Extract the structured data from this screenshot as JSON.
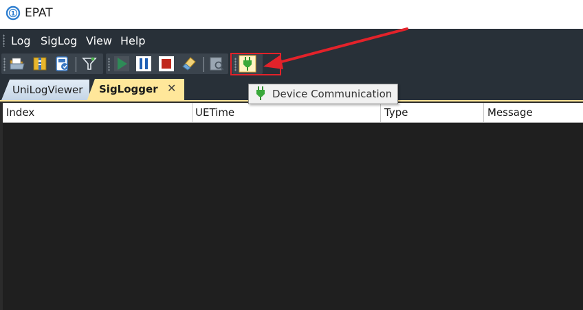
{
  "app": {
    "title": "EPAT"
  },
  "menu": {
    "items": [
      "Log",
      "SigLog",
      "View",
      "Help"
    ]
  },
  "toolbar": {
    "buttons": [
      {
        "icon": "open-folder-icon"
      },
      {
        "icon": "archive-icon"
      },
      {
        "icon": "save-log-icon"
      },
      {
        "icon": "filter-icon"
      },
      {
        "icon": "play-icon"
      },
      {
        "icon": "pause-icon"
      },
      {
        "icon": "stop-icon"
      },
      {
        "icon": "clear-icon"
      },
      {
        "icon": "search-icon"
      },
      {
        "icon": "plug-icon"
      }
    ],
    "colors": {
      "play": "#2e8b57",
      "pause": "#1f5fb4",
      "stop": "#c0281c",
      "plug": "#3aa83a"
    }
  },
  "tabs": [
    {
      "label": "UniLogViewer",
      "active": false
    },
    {
      "label": "SigLogger",
      "active": true
    }
  ],
  "tooltip": {
    "text": "Device Communication"
  },
  "grid": {
    "columns": [
      "Index",
      "UETime",
      "Type",
      "Message"
    ],
    "rows": []
  },
  "annotation": {
    "color": "#e3222a"
  }
}
